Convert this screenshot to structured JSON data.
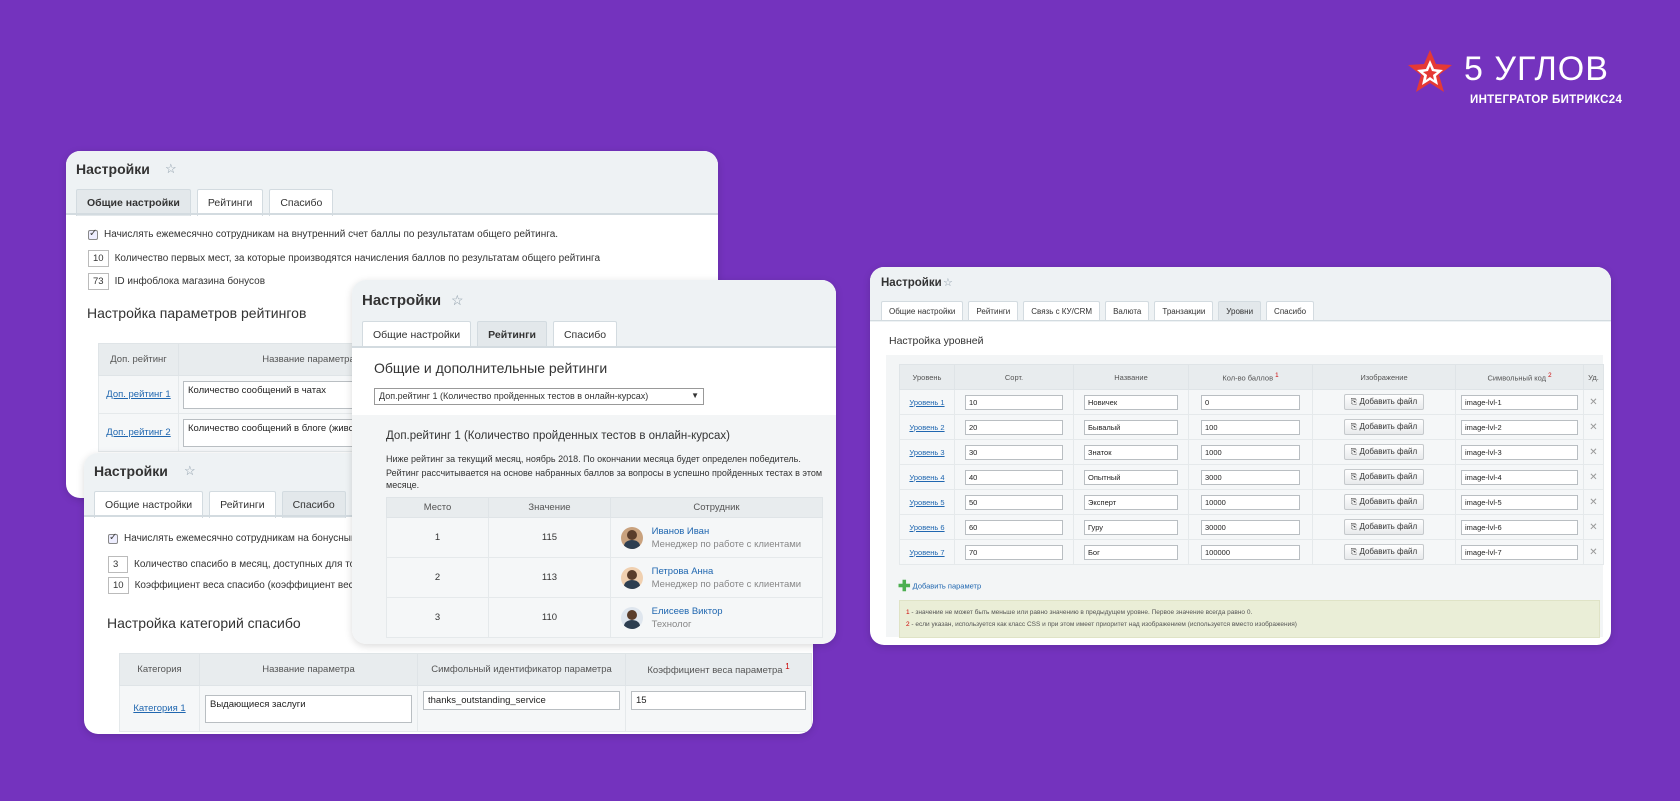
{
  "logo": {
    "title": "5 УГЛОВ",
    "subtitle": "ИНТЕГРАТОР БИТРИКС24"
  },
  "colors": {
    "background": "#7433be",
    "logo_mark": "#e53935",
    "link": "#2067b0"
  },
  "w1": {
    "title": "Настройки",
    "tabs": [
      "Общие настройки",
      "Рейтинги",
      "Спасибо"
    ],
    "check_label": "Начислять ежемесячно сотрудникам на внутренний счет баллы по результатам общего рейтинга.",
    "places_value": "10",
    "places_label": "Количество первых мест, за которые производятся начисления баллов по результатам общего рейтинга",
    "iblock_value": "73",
    "iblock_label": "ID инфоблока магазина бонусов",
    "section": "Настройка параметров рейтингов",
    "headers": [
      "Доп. рейтинг",
      "Название параметра"
    ],
    "rows": [
      {
        "link": "Доп. рейтинг 1",
        "value": "Количество сообщений в чатах"
      },
      {
        "link": "Доп. рейтинг 2",
        "value": "Количество сообщений в блоге (живой ле"
      }
    ]
  },
  "w2": {
    "title": "Настройки",
    "tabs": [
      "Общие настройки",
      "Рейтинги",
      "Спасибо"
    ],
    "check_label": "Начислять ежемесячно сотрудникам на бонусный счет б",
    "thanks_value": "3",
    "thanks_label": "Количество спасибо в месяц, доступных для того, чт",
    "coef_value": "10",
    "coef_label": "Коэффициент веса спасибо (коэффициент веса (курс",
    "section": "Настройка категорий спасибо",
    "headers": [
      "Категория",
      "Название параметра",
      "Симфольный идентификатор параметра",
      "Коэффициент веса параметра"
    ],
    "header_sup": "1",
    "row": {
      "link": "Категория 1",
      "name": "Выдающиеся заслуги",
      "code": "thanks_outstanding_service",
      "coef": "15"
    }
  },
  "w3": {
    "title": "Настройки",
    "tabs": [
      "Общие настройки",
      "Рейтинги",
      "Спасибо"
    ],
    "section": "Общие и дополнительные рейтинги",
    "select": "Доп.рейтинг 1 (Количество пройденных тестов в онлайн-курсах)",
    "block_title": "Доп.рейтинг 1 (Количество пройденных тестов в онлайн-курсах)",
    "desc1": "Ниже рейтинг за текущий месяц, ноябрь 2018. По окончании месяца будет определен победитель.",
    "desc2": "Рейтинг рассчитывается на основе набранных баллов за вопросы в успешно пройденных тестах в этом",
    "desc3": "месяце.",
    "headers": [
      "Место",
      "Значение",
      "Сотрудник"
    ],
    "rows": [
      {
        "place": "1",
        "value": "115",
        "name": "Иванов Иван",
        "role": "Менеджер по работе с клиентами"
      },
      {
        "place": "2",
        "value": "113",
        "name": "Петрова Анна",
        "role": "Менеджер по работе с клиентами"
      },
      {
        "place": "3",
        "value": "110",
        "name": "Елисеев Виктор",
        "role": "Технолог"
      }
    ]
  },
  "w4": {
    "title": "Настройки",
    "tabs": [
      "Общие настройки",
      "Рейтинги",
      "Связь с КУ/CRM",
      "Валюта",
      "Транзакции",
      "Уровни",
      "Спасибо"
    ],
    "section": "Настройка уровней",
    "headers": [
      "Уровень",
      "Сорт.",
      "Название",
      "Кол-во баллов",
      "Изображение",
      "Символьный код",
      "Уд."
    ],
    "sup1": "1",
    "sup2": "2",
    "add_file": "Добавить файл",
    "rows": [
      {
        "level": "Уровень 1",
        "sort": "10",
        "name": "Новичек",
        "points": "0",
        "code": "image-lvl-1"
      },
      {
        "level": "Уровень 2",
        "sort": "20",
        "name": "Бывалый",
        "points": "100",
        "code": "image-lvl-2"
      },
      {
        "level": "Уровень 3",
        "sort": "30",
        "name": "Знаток",
        "points": "1000",
        "code": "image-lvl-3"
      },
      {
        "level": "Уровень 4",
        "sort": "40",
        "name": "Опытный",
        "points": "3000",
        "code": "image-lvl-4"
      },
      {
        "level": "Уровень 5",
        "sort": "50",
        "name": "Эксперт",
        "points": "10000",
        "code": "image-lvl-5"
      },
      {
        "level": "Уровень 6",
        "sort": "60",
        "name": "Гуру",
        "points": "30000",
        "code": "image-lvl-6"
      },
      {
        "level": "Уровень 7",
        "sort": "70",
        "name": "Бог",
        "points": "100000",
        "code": "image-lvl-7"
      }
    ],
    "add_param": "Добавить параметр",
    "note1": " - значение не может быть меньше или равно значению в предыдущем уровне. Первое значение всегда равно 0.",
    "note2": " - если указан, используется как класс CSS и при этом имеет приоритет над изображением (используется вместо изображения)"
  }
}
